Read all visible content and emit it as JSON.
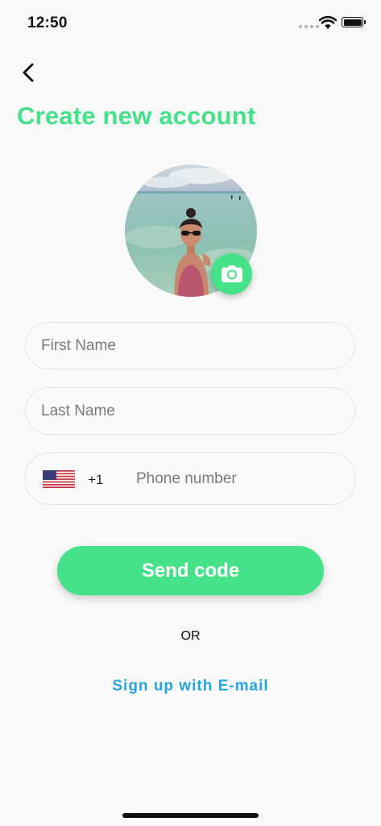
{
  "status_bar": {
    "time": "12:50"
  },
  "header": {
    "back_icon": "chevron-left-icon",
    "title": "Create new account"
  },
  "avatar": {
    "camera_icon": "camera-icon"
  },
  "form": {
    "first_name": {
      "placeholder": "First Name",
      "value": ""
    },
    "last_name": {
      "placeholder": "Last Name",
      "value": ""
    },
    "phone": {
      "country_flag": "us-flag-icon",
      "country_code": "+1",
      "placeholder": "Phone number",
      "value": ""
    }
  },
  "actions": {
    "send_code_label": "Send code",
    "or_label": "OR",
    "email_signup_label": "Sign up with E-mail"
  },
  "colors": {
    "accent": "#45e28a",
    "link": "#25a4e3",
    "background": "#f9f9f9"
  }
}
